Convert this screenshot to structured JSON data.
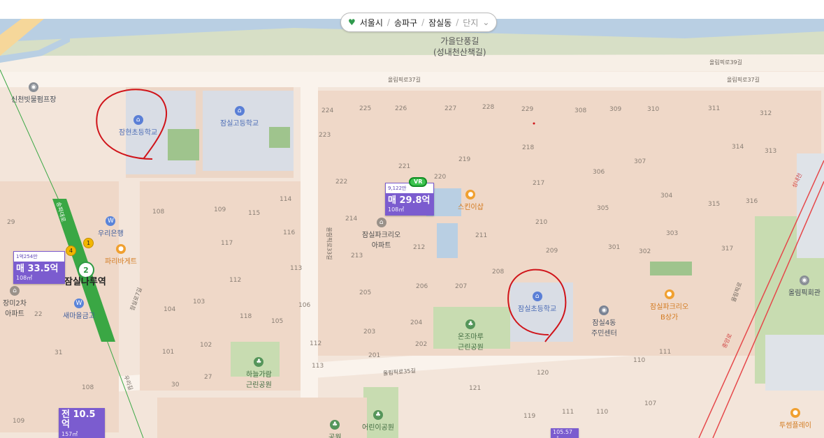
{
  "breadcrumb": {
    "items": [
      "서울시",
      "송파구",
      "잠실동"
    ],
    "more": "단지"
  },
  "area_label": {
    "line1": "가을단풍길",
    "line2": "(성내천산책길)"
  },
  "roads": [
    "올림픽로37길",
    "올림픽로37길",
    "올림픽로39길",
    "올림픽로33길",
    "올림픽로35길",
    "잠실로7길",
    "우리길",
    "송파대로",
    "올림픽로",
    "성내천",
    "중앙로"
  ],
  "pois": {
    "schools": [
      "잠현초등학교",
      "잠실고등학교",
      "잠실초등학교"
    ],
    "parks": [
      "온조마루\n근린공원",
      "하늘가람\n근린공원",
      "어린이공원",
      "공원"
    ],
    "shops": [
      "스킨이샵",
      "파리바게트",
      "잠실파크리오\nB상가",
      "투썸플레이"
    ],
    "banks": [
      "우리은행",
      "새마을금고"
    ],
    "gov": [
      "잠실4동\n주민센터",
      "신천빗물펌프장",
      "올림픽회관"
    ],
    "apts": [
      "잠실파크리오\n아파트",
      "장미2차\n아파트"
    ],
    "subway": "잠실나루역"
  },
  "buildings": [
    "224",
    "225",
    "226",
    "227",
    "228",
    "229",
    "308",
    "309",
    "310",
    "311",
    "312",
    "223",
    "218",
    "314",
    "313",
    "222",
    "221",
    "220",
    "219",
    "307",
    "306",
    "217",
    "304",
    "315",
    "316",
    "214",
    "305",
    "210",
    "303",
    "213",
    "212",
    "211",
    "209",
    "301",
    "302",
    "317",
    "208",
    "205",
    "206",
    "207",
    "203",
    "204",
    "202",
    "201",
    "121",
    "120",
    "119",
    "111",
    "110",
    "107",
    "108",
    "109",
    "115",
    "114",
    "113",
    "112",
    "116",
    "117",
    "118",
    "105",
    "106",
    "104",
    "103",
    "102",
    "101",
    "27",
    "30",
    "29",
    "31",
    "22",
    "108",
    "109",
    "110",
    "111",
    "112",
    "113"
  ],
  "prices": [
    {
      "per_pyeong": "9,122만",
      "value": "매 29.8억",
      "area": "108㎡"
    },
    {
      "per_pyeong": "1억254만",
      "value": "매 33.5억",
      "area": "108㎡"
    },
    {
      "per_pyeong": "",
      "value": "전 10.5억",
      "area": "157㎡"
    },
    {
      "per_pyeong": "",
      "value": "105.57㎡",
      "area": ""
    }
  ],
  "vr_badge": "VR",
  "subway_line": "2",
  "exits": [
    "4",
    "1"
  ],
  "colors": {
    "land": "#f3e5da",
    "block": "#ecd6c6",
    "road": "#faf3ec",
    "park": "#c8dcb1",
    "water": "#b9cfe3",
    "line2": "#3aa744",
    "price": "#7b5ccf",
    "red_circle": "#d0141a"
  }
}
